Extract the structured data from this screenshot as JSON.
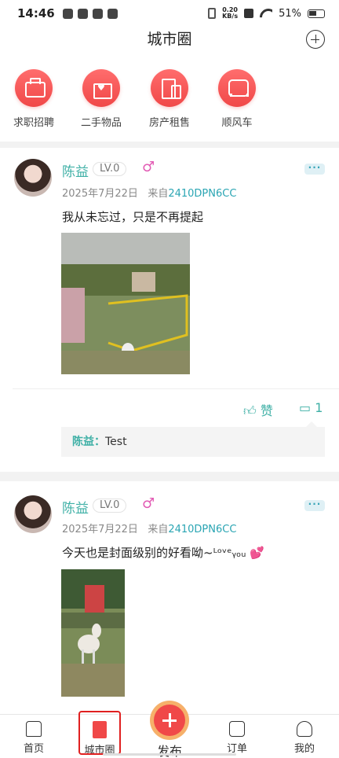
{
  "status": {
    "time": "14:46",
    "net_speed": "0.20",
    "net_unit": "KB/s",
    "battery": "51%"
  },
  "header": {
    "title": "城市圈"
  },
  "categories": [
    {
      "label": "求职招聘",
      "icon": "briefcase-icon"
    },
    {
      "label": "二手物品",
      "icon": "gift-box-icon"
    },
    {
      "label": "房产租售",
      "icon": "building-icon"
    },
    {
      "label": "顺风车",
      "icon": "car-icon"
    }
  ],
  "posts": [
    {
      "author": "陈益",
      "level": "LV.0",
      "gender": "♂",
      "date": "2025年7月22日",
      "source_prefix": "来自",
      "device": "2410DPN6CC",
      "text": "我从未忘过，只是不再提起",
      "like_label": "赞",
      "comment_count": "1",
      "comments": [
        {
          "name": "陈益：",
          "text": "Test"
        }
      ]
    },
    {
      "author": "陈益",
      "level": "LV.0",
      "gender": "♂",
      "date": "2025年7月22日",
      "source_prefix": "来自",
      "device": "2410DPN6CC",
      "text": "今天也是封面级别的好看呦~ᴸᵒᵛᵉᵧₒᵤ 💕"
    }
  ],
  "nav": {
    "items": [
      "首页",
      "城市圈",
      "订单",
      "我的"
    ],
    "publish": "发布"
  },
  "colors": {
    "accent": "#f04848",
    "teal": "#3fb0a6"
  }
}
